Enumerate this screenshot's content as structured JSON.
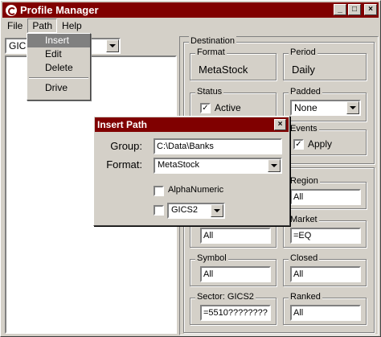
{
  "window": {
    "title": "Profile Manager"
  },
  "titlebar_buttons": [
    "_",
    "□",
    "×"
  ],
  "menu": [
    {
      "label": "File"
    },
    {
      "label": "Path"
    },
    {
      "label": "Help"
    }
  ],
  "path_menu": {
    "items": [
      {
        "label": "Insert"
      },
      {
        "label": "Edit"
      },
      {
        "label": "Delete"
      },
      {
        "label": "Drive"
      }
    ]
  },
  "left": {
    "combo_value": "GICS"
  },
  "destination": {
    "label": "Destination",
    "format": {
      "label": "Format",
      "value": "MetaStock"
    },
    "period": {
      "label": "Period",
      "value": "Daily"
    },
    "status": {
      "label": "Status",
      "checkbox_label": "Active",
      "checked": true
    },
    "padded": {
      "label": "Padded",
      "value": "None"
    },
    "events": {
      "label": "Events",
      "checkbox_label": "Apply",
      "checked": true
    }
  },
  "filters": {
    "region": {
      "label": "Region",
      "value": "All"
    },
    "exchange": {
      "value": "All"
    },
    "market": {
      "label": "Market",
      "value": "=EQ"
    },
    "symbol": {
      "label": "Symbol",
      "value": "All"
    },
    "closed": {
      "label": "Closed",
      "value": "All"
    },
    "sector": {
      "label": "Sector: GICS2",
      "value": "=5510????????"
    },
    "ranked": {
      "label": "Ranked",
      "value": "All"
    }
  },
  "dialog": {
    "title": "Insert Path",
    "group_label": "Group:",
    "group_value": "C:\\Data\\Banks",
    "format_label": "Format:",
    "format_value": "MetaStock",
    "alphanumeric_label": "AlphaNumeric",
    "gics_value": "GICS2"
  },
  "colors": {
    "title_bar": "#800000",
    "face": "#d4d0c8"
  }
}
